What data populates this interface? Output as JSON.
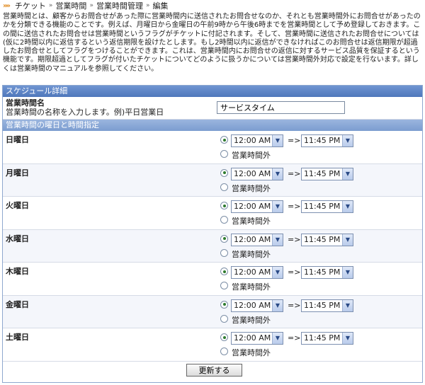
{
  "breadcrumb": [
    "チケット",
    "営業時間",
    "営業時間管理",
    "編集"
  ],
  "description": "営業時間とは、顧客からお問合せがあった際に営業時間内に送信されたお問合せなのか、それとも営業時間外にお問合せがあったのかを分類できる機能のことです。例えば、月曜日から金曜日の午前9時から午後6時までを営業時間として予め登録しておきます。この間に送信されたお問合せは営業時間というフラグがチケットに付記されます。そして、営業時間に送信されたお問合せについては(仮に2時間以内に返信するという返信期限を設けたとします。もし2時間以内に返信ができなければこのお問合せは返信期限が超過したお問合せとしてフラグをつけることができます。これは、営業時間内にお問合せの返信に対するサービス品質を保証するという機能です。期限超過としてフラグが付いたチケットについてどのように扱うかについては営業時間外対応で設定を行ないます。詳しくは営業時間のマニュアルを参照してください。",
  "panel_title": "スケジュール詳細",
  "name_field": {
    "label": "営業時間名",
    "hint": "営業時間の名称を入力します。例)平日営業日",
    "value": "サービスタイム"
  },
  "section_title": "営業時間の曜日と時間指定",
  "arrow_text": "=>",
  "closed_label": "営業時間外",
  "days": [
    {
      "label": "日曜日",
      "start": "12:00 AM",
      "end": "11:45 PM"
    },
    {
      "label": "月曜日",
      "start": "12:00 AM",
      "end": "11:45 PM"
    },
    {
      "label": "火曜日",
      "start": "12:00 AM",
      "end": "11:45 PM"
    },
    {
      "label": "水曜日",
      "start": "12:00 AM",
      "end": "11:45 PM"
    },
    {
      "label": "木曜日",
      "start": "12:00 AM",
      "end": "11:45 PM"
    },
    {
      "label": "金曜日",
      "start": "12:00 AM",
      "end": "11:45 PM"
    },
    {
      "label": "土曜日",
      "start": "12:00 AM",
      "end": "11:45 PM"
    }
  ],
  "submit_label": "更新する"
}
